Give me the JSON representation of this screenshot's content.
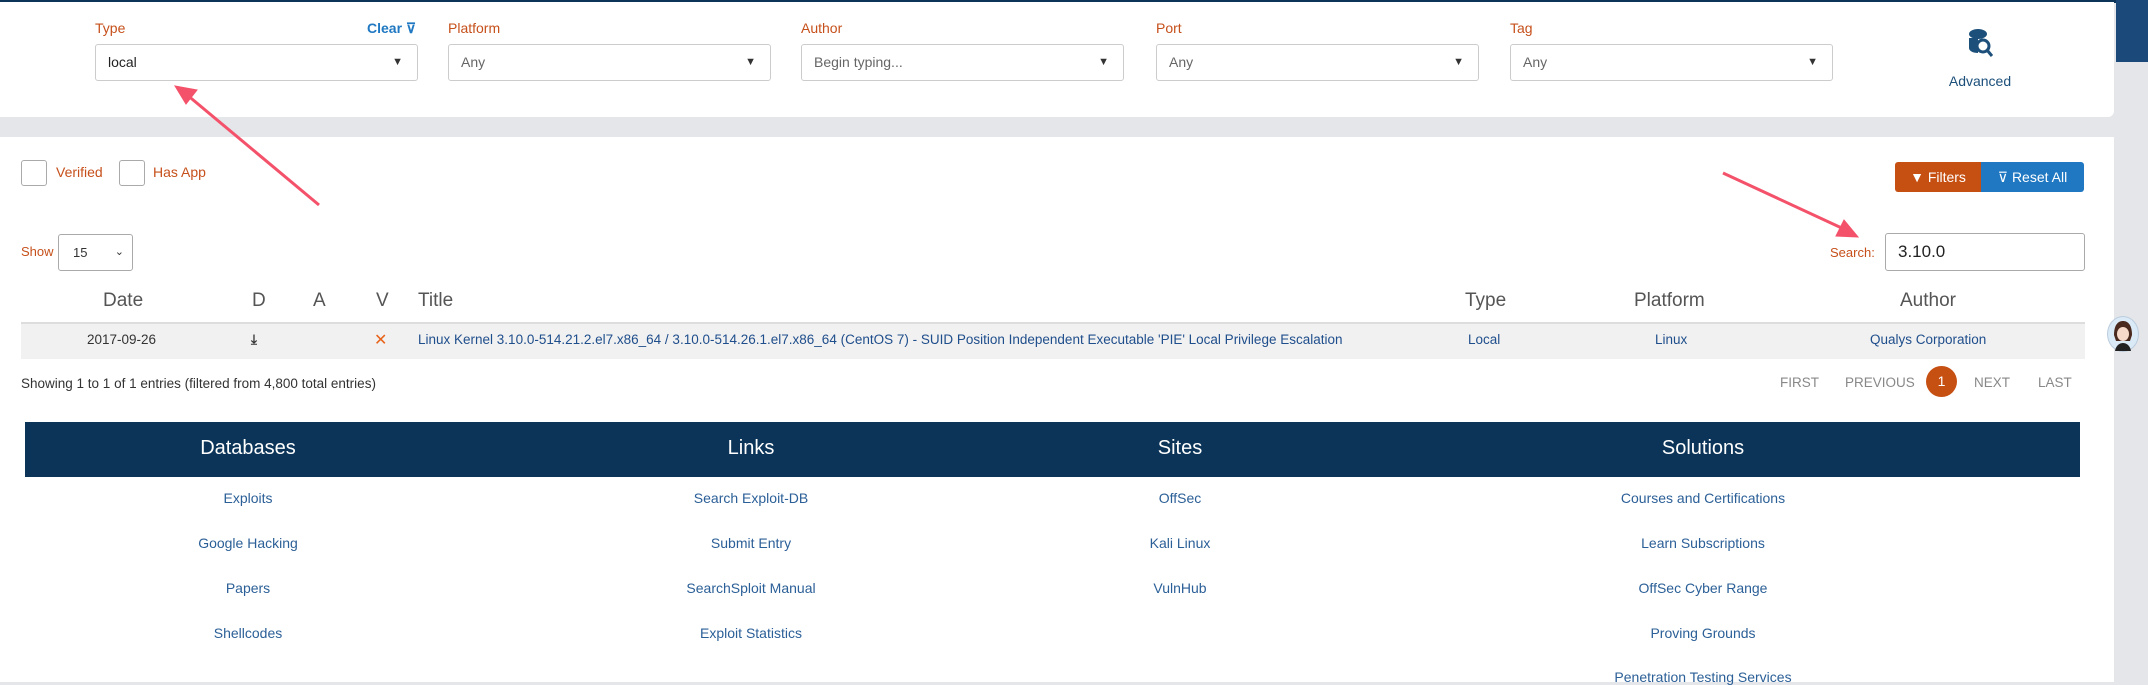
{
  "filters": {
    "type": {
      "label": "Type",
      "value": "local"
    },
    "clear_label": "Clear",
    "platform": {
      "label": "Platform",
      "value": "Any"
    },
    "author": {
      "label": "Author",
      "placeholder": "Begin typing..."
    },
    "port": {
      "label": "Port",
      "value": "Any"
    },
    "tag": {
      "label": "Tag",
      "value": "Any"
    },
    "advanced_label": "Advanced"
  },
  "toolbar": {
    "verified": "Verified",
    "has_app": "Has App",
    "filters": "Filters",
    "reset_all": "Reset All",
    "show_label": "Show",
    "show_value": "15",
    "search_label": "Search:",
    "search_value": "3.10.0"
  },
  "table": {
    "headers": [
      "Date",
      "D",
      "A",
      "V",
      "Title",
      "Type",
      "Platform",
      "Author"
    ],
    "rows": [
      {
        "date": "2017-09-26",
        "title": "Linux Kernel 3.10.0-514.21.2.el7.x86_64 / 3.10.0-514.26.1.el7.x86_64 (CentOS 7) - SUID Position Independent Executable 'PIE' Local Privilege Escalation",
        "type": "Local",
        "platform": "Linux",
        "author": "Qualys Corporation",
        "verified_mark": "✕"
      }
    ],
    "info": "Showing 1 to 1 of 1 entries (filtered from 4,800 total entries)"
  },
  "pagination": {
    "first": "FIRST",
    "previous": "PREVIOUS",
    "current": "1",
    "next": "NEXT",
    "last": "LAST"
  },
  "footer": {
    "columns": [
      {
        "title": "Databases",
        "links": [
          "Exploits",
          "Google Hacking",
          "Papers",
          "Shellcodes"
        ]
      },
      {
        "title": "Links",
        "links": [
          "Search Exploit-DB",
          "Submit Entry",
          "SearchSploit Manual",
          "Exploit Statistics"
        ]
      },
      {
        "title": "Sites",
        "links": [
          "OffSec",
          "Kali Linux",
          "VulnHub"
        ]
      },
      {
        "title": "Solutions",
        "links": [
          "Courses and Certifications",
          "Learn Subscriptions",
          "OffSec Cyber Range",
          "Proving Grounds",
          "Penetration Testing Services"
        ]
      }
    ]
  },
  "colors": {
    "accent": "#c64f12",
    "blue": "#1f78c1",
    "navy": "#0b3458",
    "annotation": "#f4526a"
  }
}
